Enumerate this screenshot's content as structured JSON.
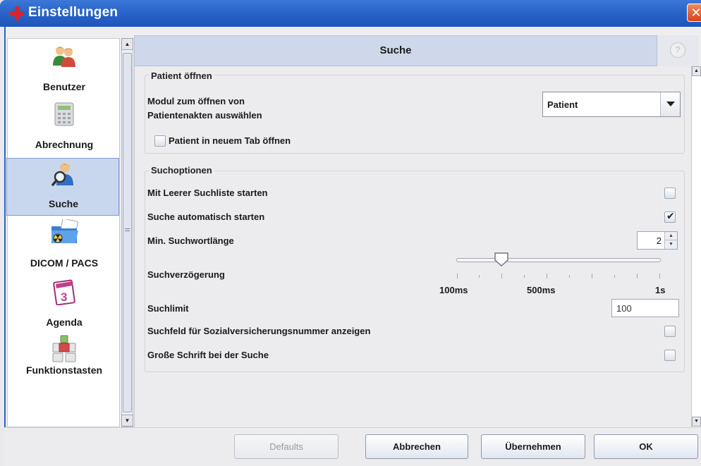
{
  "window": {
    "title": "Einstellungen"
  },
  "nav": {
    "items": [
      {
        "label": "Benutzer",
        "icon": "users-icon"
      },
      {
        "label": "Abrechnung",
        "icon": "calculator-icon"
      },
      {
        "label": "Suche",
        "icon": "search-user-icon",
        "selected": true
      },
      {
        "label": "DICOM / PACS",
        "icon": "dicom-folder-icon"
      },
      {
        "label": "Agenda",
        "icon": "calendar-icon"
      },
      {
        "label": "Funktionstasten",
        "icon": "function-keys-icon"
      }
    ]
  },
  "header": {
    "title": "Suche",
    "help": "?"
  },
  "patient_group": {
    "title": "Patient öffnen",
    "module_label_line1": "Modul zum öffnen von",
    "module_label_line2": "Patientenakten auswählen",
    "module_value": "Patient",
    "new_tab_label": "Patient in neuem Tab öffnen",
    "new_tab_checked": false
  },
  "search_group": {
    "title": "Suchoptionen",
    "empty_list_label": "Mit Leerer Suchliste starten",
    "empty_list_checked": false,
    "auto_start_label": "Suche automatisch starten",
    "auto_start_checked": true,
    "auto_start_mark": "✔",
    "min_length_label": "Min. Suchwortlänge",
    "min_length_value": "2",
    "delay_label": "Suchverzögerung",
    "delay_ticks": [
      "100ms",
      "500ms",
      "1s"
    ],
    "delay_fraction": 0.22,
    "limit_label": "Suchlimit",
    "limit_value": "100",
    "ssn_label": "Suchfeld für Sozialversicherungsnummer anzeigen",
    "ssn_checked": false,
    "large_font_label": "Große Schrift bei der Suche",
    "large_font_checked": false
  },
  "buttons": {
    "defaults": "Defaults",
    "cancel": "Abbrechen",
    "apply": "Übernehmen",
    "ok": "OK"
  },
  "colors": {
    "titlebar": "#2a64c8",
    "selected_nav": "#c9d7ee",
    "header": "#cfd8ea"
  }
}
